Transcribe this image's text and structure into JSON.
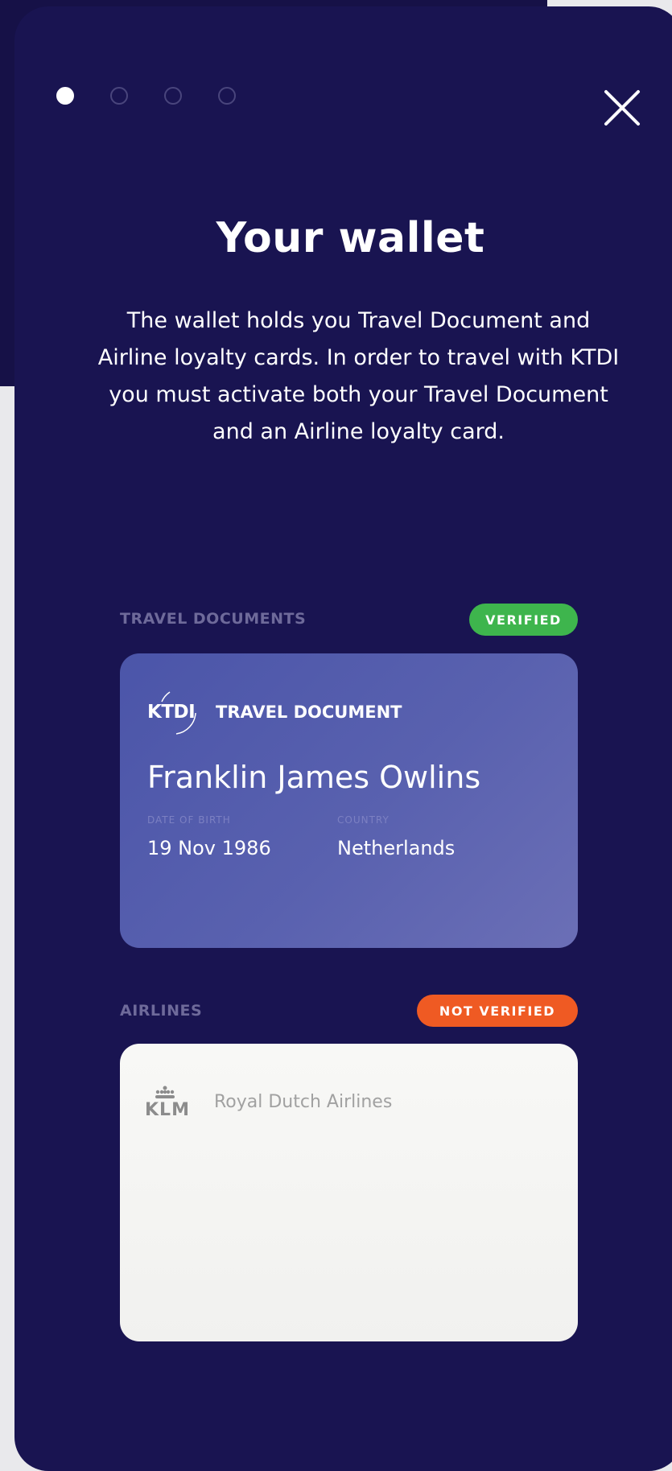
{
  "onboarding": {
    "pages_total": 4,
    "current_page": 1
  },
  "title": "Your wallet",
  "intro": "The wallet holds you Travel Document and Airline loyalty cards. In order to travel with KTDI you must activate both your Travel Document and an Airline loyalty card.",
  "travel_documents": {
    "section_label": "TRAVEL DOCUMENTS",
    "status": "VERIFIED",
    "status_color": "#3eb54d",
    "card": {
      "logo_text": "KTDI",
      "type": "TRAVEL DOCUMENT",
      "holder_name": "Franklin James Owlins",
      "dob_label": "DATE OF BIRTH",
      "dob": "19 Nov 1986",
      "country_label": "COUNTRY",
      "country": "Netherlands"
    }
  },
  "airlines": {
    "section_label": "AIRLINES",
    "status": "NOT VERIFIED",
    "status_color": "#ef5a23",
    "card": {
      "logo_text": "KLM",
      "name": "Royal Dutch Airlines"
    }
  },
  "colors": {
    "background": "#191451",
    "document_card": "#5961af",
    "airline_card": "#f4f4f2"
  },
  "icons": {
    "close": "close-icon",
    "ktdi": "ktdi-logo-icon",
    "klm": "klm-crown-icon"
  }
}
